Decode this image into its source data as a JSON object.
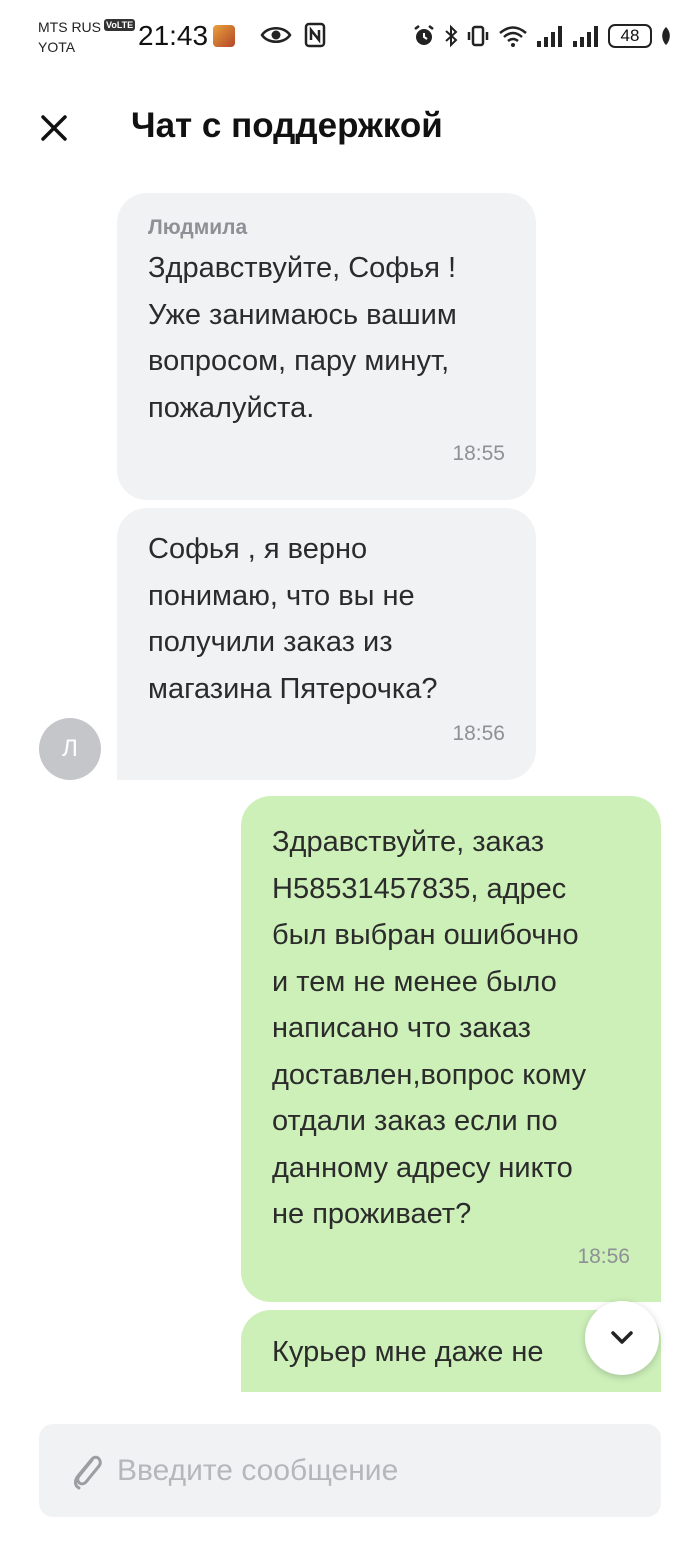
{
  "status_bar": {
    "carrier_1": "MTS RUS",
    "carrier_2": "YOTA",
    "volte": "VoLTE",
    "time": "21:43",
    "battery": "48"
  },
  "header": {
    "title": "Чат с поддержкой",
    "close_icon": "close-icon"
  },
  "messages": [
    {
      "direction": "incoming",
      "sender": "Людмила",
      "text": "Здравствуйте, Софья !\nУже занимаюсь вашим\nвопросом, пару минут,\nпожалуйста.",
      "time": "18:55"
    },
    {
      "direction": "incoming",
      "text": "Софья , я верно\nпонимаю, что вы не\nполучили заказ из\nмагазина Пятерочка?",
      "time": "18:56"
    },
    {
      "direction": "outgoing",
      "text": "Здравствуйте, заказ\nН58531457835, адрес\nбыл выбран ошибочно\nи тем не менее было\nнаписано что заказ\nдоставлен,вопрос кому\nотдали заказ если по\nданному адресу никто\nне проживает?",
      "time": "18:56"
    },
    {
      "direction": "outgoing",
      "text": "Курьер мне даже не"
    }
  ],
  "avatar_letter": "Л",
  "composer": {
    "placeholder": "Введите сообщение",
    "value": ""
  },
  "colors": {
    "incoming_bubble": "#f1f2f4",
    "outgoing_bubble": "#cdf0b9",
    "meta_text": "#8e9095"
  }
}
